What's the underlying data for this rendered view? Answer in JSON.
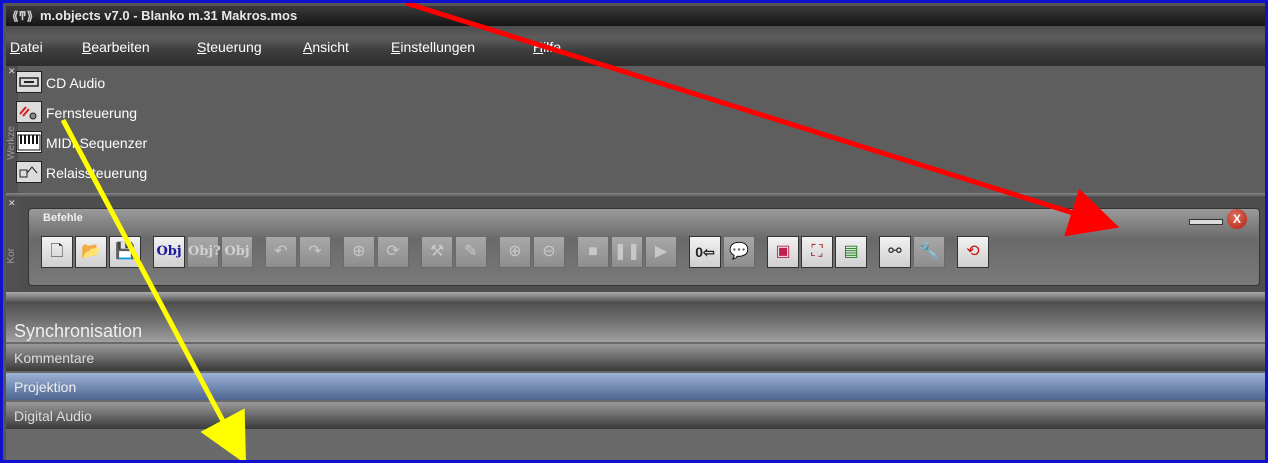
{
  "window": {
    "title": "m.objects v7.0 - Blanko m.31 Makros.mos"
  },
  "menu": [
    "Datei",
    "Bearbeiten",
    "Steuerung",
    "Ansicht",
    "Einstellungen",
    "Hilfe"
  ],
  "tools": {
    "grip_label": "Werkze",
    "items": [
      {
        "label": "CD Audio",
        "icon": "cd-audio-icon"
      },
      {
        "label": "Fernsteuerung",
        "icon": "remote-control-icon"
      },
      {
        "label": "MIDI Sequenzer",
        "icon": "midi-keyboard-icon"
      },
      {
        "label": "Relaissteuerung",
        "icon": "relay-icon"
      }
    ]
  },
  "commands": {
    "grip_label": "Kor",
    "title": "Befehle",
    "close_label": "X",
    "buttons": {
      "obj_new": "Obj",
      "obj_info": "Obj?",
      "obj_delete": "Obj",
      "counter": "0⇦"
    }
  },
  "tracks": [
    "Synchronisation",
    "Kommentare",
    "Projektion",
    "Digital Audio"
  ],
  "colors": {
    "frame": "#1010d0",
    "arrow_red": "#ff0000",
    "arrow_yellow": "#ffff00",
    "projektion_track": "#6f86b0"
  }
}
